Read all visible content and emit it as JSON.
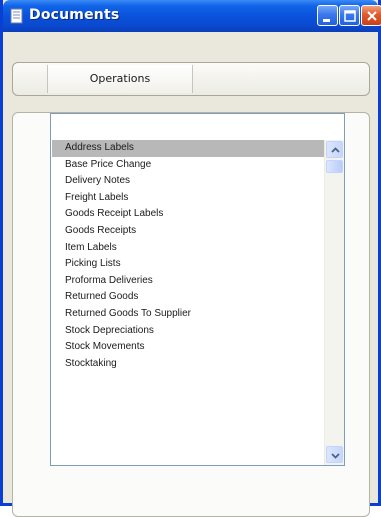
{
  "window": {
    "title": "Documents",
    "title_icon": "documents-icon",
    "controls": [
      "minimize-icon",
      "maximize-icon",
      "close-icon"
    ]
  },
  "tabs": [
    {
      "label": "Operations",
      "selected": true
    }
  ],
  "list": {
    "items": [
      "Address Labels",
      "Base Price Change",
      "Delivery Notes",
      "Freight Labels",
      "Goods Receipt Labels",
      "Goods Receipts",
      "Item Labels",
      "Picking Lists",
      "Proforma Deliveries",
      "Returned Goods",
      "Returned Goods To Supplier",
      "Stock Depreciations",
      "Stock Movements",
      "Stocktaking"
    ],
    "selected_index": 0,
    "scroll_icons": [
      "scroll-up-icon",
      "scroll-down-icon"
    ]
  },
  "colors": {
    "titlebar": "#0a52dc",
    "window_border": "#0a3fd6",
    "selection": "#b8b8b8",
    "close_button": "#e05a2c"
  }
}
